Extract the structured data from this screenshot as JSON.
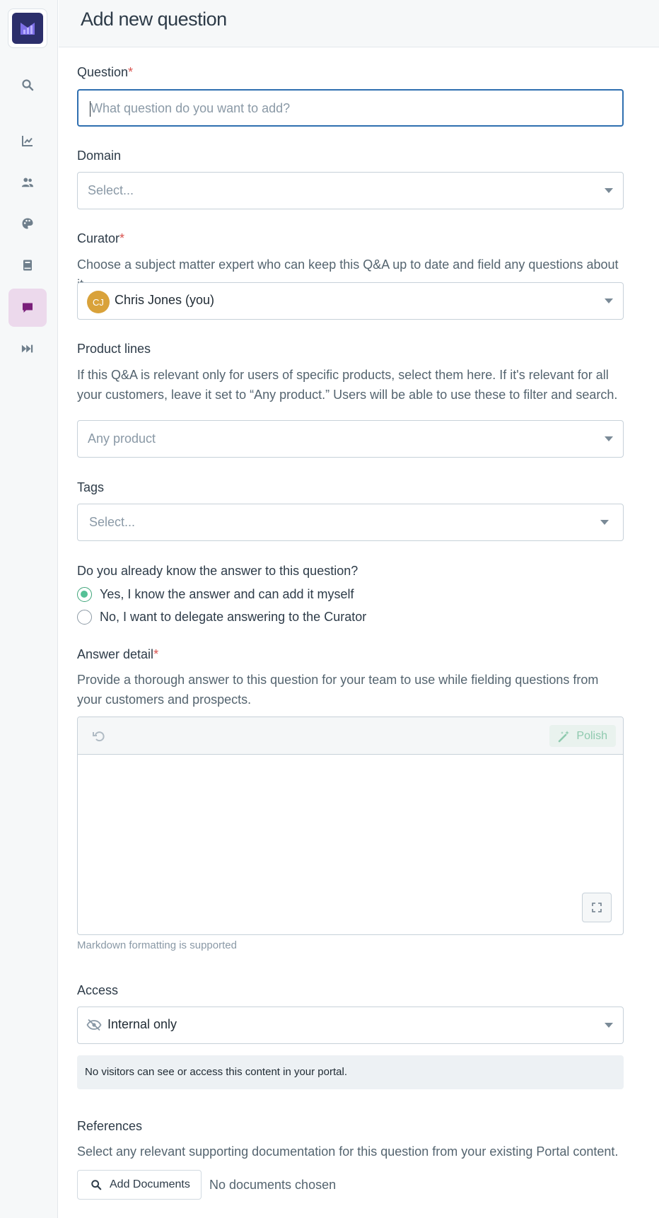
{
  "sidebar": {
    "items": [
      {
        "icon": "search-icon"
      },
      {
        "icon": "chart-icon"
      },
      {
        "icon": "users-icon"
      },
      {
        "icon": "palette-icon"
      },
      {
        "icon": "book-icon"
      },
      {
        "icon": "chat-icon",
        "active": true
      },
      {
        "icon": "fast-forward-icon"
      }
    ],
    "accent": "#7a1f7a"
  },
  "header": {
    "title": "Add new question"
  },
  "form": {
    "question": {
      "label": "Question",
      "required_mark": "*",
      "placeholder": "What question do you want to add?"
    },
    "domain": {
      "label": "Domain",
      "placeholder": "Select..."
    },
    "curator": {
      "label": "Curator",
      "required_mark": "*",
      "help": "Choose a subject matter expert who can keep this Q&A up to date and field any questions about it.",
      "avatar_initials": "CJ",
      "value": "Chris Jones (you)"
    },
    "product_lines": {
      "label": "Product lines",
      "help": "If this Q&A is relevant only for users of specific products, select them here. If it's relevant for all your customers, leave it set to “Any product.” Users will be able to use these to filter and search.",
      "placeholder": "Any product"
    },
    "tags": {
      "label": "Tags",
      "placeholder": "Select..."
    },
    "know_answer": {
      "label": "Do you already know the answer to this question?",
      "options": [
        {
          "label": "Yes, I know the answer and can add it myself",
          "checked": true
        },
        {
          "label": "No, I want to delegate answering to the Curator",
          "checked": false
        }
      ]
    },
    "answer_detail": {
      "label": "Answer detail",
      "required_mark": "*",
      "help": "Provide a thorough answer to this question for your team to use while fielding questions from your customers and prospects.",
      "polish_label": "Polish",
      "note": "Markdown formatting is supported"
    },
    "access": {
      "label": "Access",
      "value": "Internal only",
      "info": "No visitors can see or access this content in your portal."
    },
    "references": {
      "label": "References",
      "help": "Select any relevant supporting documentation for this question from your existing Portal content.",
      "button_label": "Add Documents",
      "empty_text": "No documents chosen"
    }
  }
}
